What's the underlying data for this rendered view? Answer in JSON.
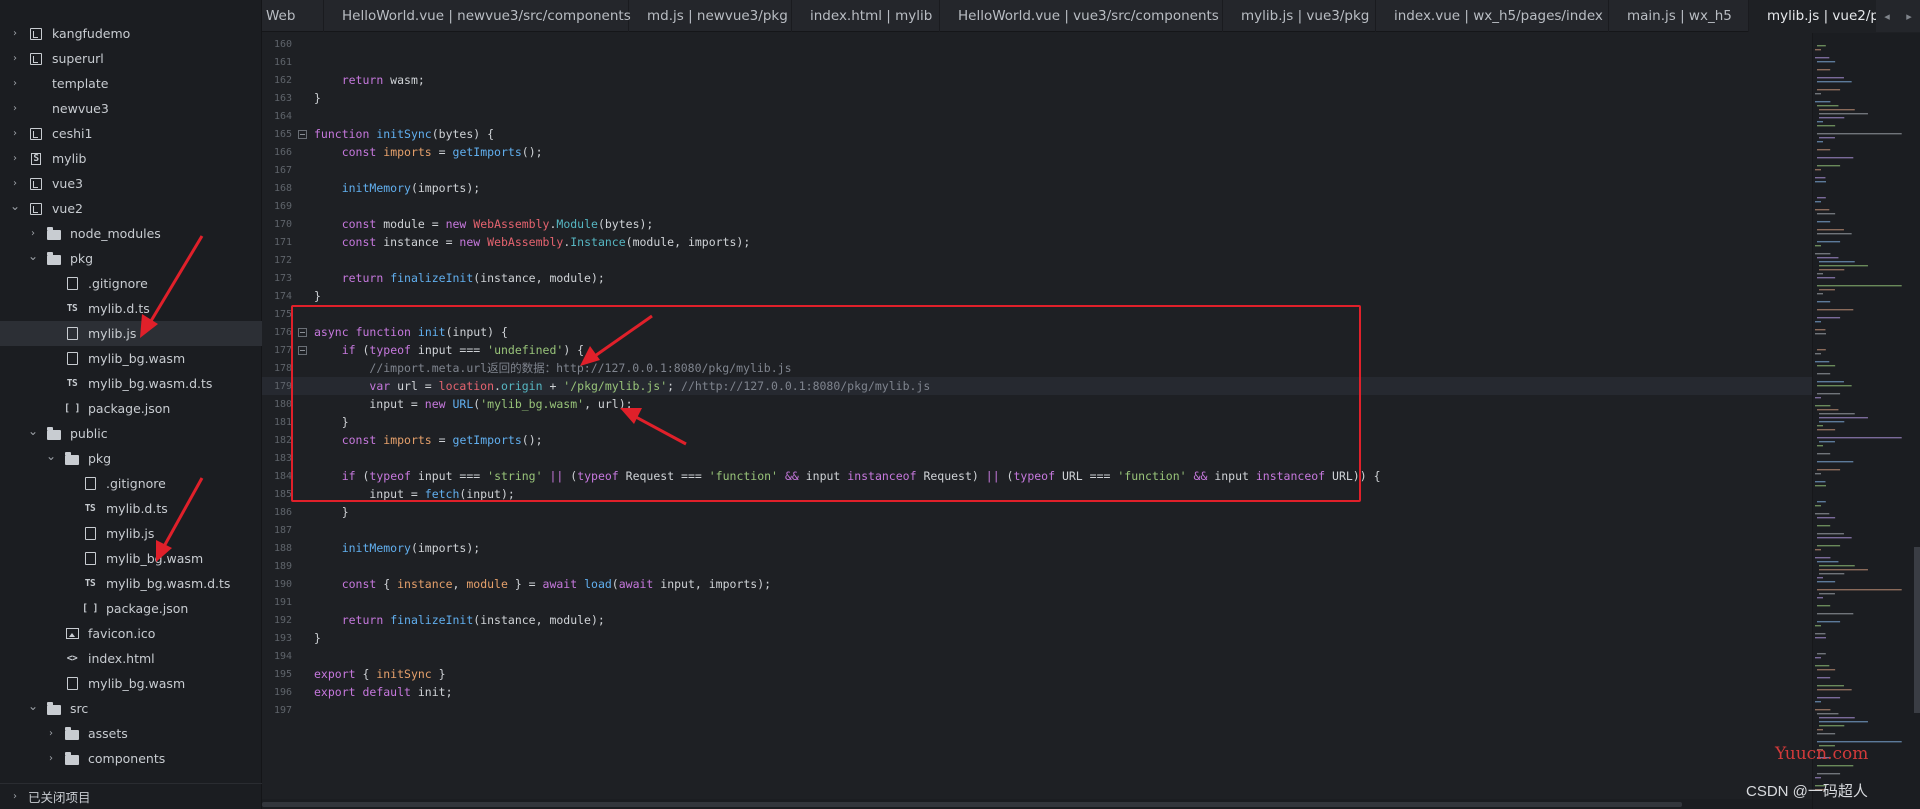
{
  "sidebar": {
    "items": [
      {
        "label": "kangfudemo",
        "depth": 0,
        "chevron": "right",
        "icon": "project-icon"
      },
      {
        "label": "superurl",
        "depth": 0,
        "chevron": "right",
        "icon": "project-icon"
      },
      {
        "label": "template",
        "depth": 0,
        "chevron": "right",
        "icon": "none"
      },
      {
        "label": "newvue3",
        "depth": 0,
        "chevron": "right",
        "icon": "none"
      },
      {
        "label": "ceshi1",
        "depth": 0,
        "chevron": "right",
        "icon": "project-icon"
      },
      {
        "label": "mylib",
        "depth": 0,
        "chevron": "right",
        "icon": "rust-project-icon"
      },
      {
        "label": "vue3",
        "depth": 0,
        "chevron": "right",
        "icon": "project-icon"
      },
      {
        "label": "vue2",
        "depth": 0,
        "chevron": "down",
        "icon": "project-icon"
      },
      {
        "label": "node_modules",
        "depth": 1,
        "chevron": "right",
        "icon": "folder-icon"
      },
      {
        "label": "pkg",
        "depth": 1,
        "chevron": "down",
        "icon": "folder-icon"
      },
      {
        "label": ".gitignore",
        "depth": 2,
        "chevron": "none",
        "icon": "file-icon"
      },
      {
        "label": "mylib.d.ts",
        "depth": 2,
        "chevron": "none",
        "icon": "ts-file-icon"
      },
      {
        "label": "mylib.js",
        "depth": 2,
        "chevron": "none",
        "icon": "js-file-icon",
        "selected": true
      },
      {
        "label": "mylib_bg.wasm",
        "depth": 2,
        "chevron": "none",
        "icon": "file-icon"
      },
      {
        "label": "mylib_bg.wasm.d.ts",
        "depth": 2,
        "chevron": "none",
        "icon": "ts-file-icon"
      },
      {
        "label": "package.json",
        "depth": 2,
        "chevron": "none",
        "icon": "json-file-icon"
      },
      {
        "label": "public",
        "depth": 1,
        "chevron": "down",
        "icon": "folder-icon"
      },
      {
        "label": "pkg",
        "depth": 2,
        "chevron": "down",
        "icon": "folder-icon"
      },
      {
        "label": ".gitignore",
        "depth": 3,
        "chevron": "none",
        "icon": "file-icon"
      },
      {
        "label": "mylib.d.ts",
        "depth": 3,
        "chevron": "none",
        "icon": "ts-file-icon"
      },
      {
        "label": "mylib.js",
        "depth": 3,
        "chevron": "none",
        "icon": "js-file-icon"
      },
      {
        "label": "mylib_bg.wasm",
        "depth": 3,
        "chevron": "none",
        "icon": "file-icon"
      },
      {
        "label": "mylib_bg.wasm.d.ts",
        "depth": 3,
        "chevron": "none",
        "icon": "ts-file-icon"
      },
      {
        "label": "package.json",
        "depth": 3,
        "chevron": "none",
        "icon": "json-file-icon"
      },
      {
        "label": "favicon.ico",
        "depth": 2,
        "chevron": "none",
        "icon": "image-file-icon"
      },
      {
        "label": "index.html",
        "depth": 2,
        "chevron": "none",
        "icon": "html-file-icon"
      },
      {
        "label": "mylib_bg.wasm",
        "depth": 2,
        "chevron": "none",
        "icon": "file-icon"
      },
      {
        "label": "src",
        "depth": 1,
        "chevron": "down",
        "icon": "folder-icon"
      },
      {
        "label": "assets",
        "depth": 2,
        "chevron": "right",
        "icon": "folder-icon"
      },
      {
        "label": "components",
        "depth": 2,
        "chevron": "right",
        "icon": "folder-icon"
      }
    ],
    "footer_label": "已关闭项目"
  },
  "tabs": [
    {
      "label": "Web",
      "active": false
    },
    {
      "label": "HelloWorld.vue | newvue3/src/components",
      "active": false
    },
    {
      "label": "md.js | newvue3/pkg",
      "active": false
    },
    {
      "label": "index.html | mylib",
      "active": false
    },
    {
      "label": "HelloWorld.vue | vue3/src/components",
      "active": false
    },
    {
      "label": "mylib.js | vue3/pkg",
      "active": false
    },
    {
      "label": "index.vue | wx_h5/pages/index",
      "active": false
    },
    {
      "label": "main.js | wx_h5",
      "active": false
    },
    {
      "label": "mylib.js | vue2/pkg",
      "active": true
    }
  ],
  "tab_nav": {
    "prev": "◂",
    "next": "▸"
  },
  "editor": {
    "current_line": 179,
    "lines": [
      {
        "n": 160,
        "fold": false,
        "tokens": []
      },
      {
        "n": 161,
        "fold": false,
        "tokens": []
      },
      {
        "n": 162,
        "fold": false,
        "tokens": [
          {
            "t": "    ",
            "c": ""
          },
          {
            "t": "return",
            "c": "kw"
          },
          {
            "t": " wasm;",
            "c": ""
          }
        ]
      },
      {
        "n": 163,
        "fold": false,
        "tokens": [
          {
            "t": "}",
            "c": ""
          }
        ]
      },
      {
        "n": 164,
        "fold": false,
        "tokens": []
      },
      {
        "n": 165,
        "fold": true,
        "tokens": [
          {
            "t": "function",
            "c": "kw"
          },
          {
            "t": " ",
            "c": ""
          },
          {
            "t": "initSync",
            "c": "fn"
          },
          {
            "t": "(bytes) {",
            "c": ""
          }
        ]
      },
      {
        "n": 166,
        "fold": false,
        "tokens": [
          {
            "t": "    ",
            "c": ""
          },
          {
            "t": "const",
            "c": "kw"
          },
          {
            "t": " ",
            "c": ""
          },
          {
            "t": "imports",
            "c": "var"
          },
          {
            "t": " = ",
            "c": ""
          },
          {
            "t": "getImports",
            "c": "fn"
          },
          {
            "t": "();",
            "c": ""
          }
        ]
      },
      {
        "n": 167,
        "fold": false,
        "tokens": []
      },
      {
        "n": 168,
        "fold": false,
        "tokens": [
          {
            "t": "    ",
            "c": ""
          },
          {
            "t": "initMemory",
            "c": "fn"
          },
          {
            "t": "(imports);",
            "c": ""
          }
        ]
      },
      {
        "n": 169,
        "fold": false,
        "tokens": []
      },
      {
        "n": 170,
        "fold": false,
        "tokens": [
          {
            "t": "    ",
            "c": ""
          },
          {
            "t": "const",
            "c": "kw"
          },
          {
            "t": " module = ",
            "c": ""
          },
          {
            "t": "new",
            "c": "kw"
          },
          {
            "t": " ",
            "c": ""
          },
          {
            "t": "WebAssembly",
            "c": "cls"
          },
          {
            "t": ".",
            "c": ""
          },
          {
            "t": "Module",
            "c": "prop"
          },
          {
            "t": "(bytes);",
            "c": ""
          }
        ]
      },
      {
        "n": 171,
        "fold": false,
        "tokens": [
          {
            "t": "    ",
            "c": ""
          },
          {
            "t": "const",
            "c": "kw"
          },
          {
            "t": " instance = ",
            "c": ""
          },
          {
            "t": "new",
            "c": "kw"
          },
          {
            "t": " ",
            "c": ""
          },
          {
            "t": "WebAssembly",
            "c": "cls"
          },
          {
            "t": ".",
            "c": ""
          },
          {
            "t": "Instance",
            "c": "prop"
          },
          {
            "t": "(module, imports);",
            "c": ""
          }
        ]
      },
      {
        "n": 172,
        "fold": false,
        "tokens": []
      },
      {
        "n": 173,
        "fold": false,
        "tokens": [
          {
            "t": "    ",
            "c": ""
          },
          {
            "t": "return",
            "c": "kw"
          },
          {
            "t": " ",
            "c": ""
          },
          {
            "t": "finalizeInit",
            "c": "fn"
          },
          {
            "t": "(instance, module);",
            "c": ""
          }
        ]
      },
      {
        "n": 174,
        "fold": false,
        "tokens": [
          {
            "t": "}",
            "c": ""
          }
        ]
      },
      {
        "n": 175,
        "fold": false,
        "tokens": []
      },
      {
        "n": 176,
        "fold": true,
        "tokens": [
          {
            "t": "async",
            "c": "kw"
          },
          {
            "t": " ",
            "c": ""
          },
          {
            "t": "function",
            "c": "kw"
          },
          {
            "t": " ",
            "c": ""
          },
          {
            "t": "init",
            "c": "fn"
          },
          {
            "t": "(input) {",
            "c": ""
          }
        ]
      },
      {
        "n": 177,
        "fold": true,
        "tokens": [
          {
            "t": "    ",
            "c": ""
          },
          {
            "t": "if",
            "c": "kw"
          },
          {
            "t": " (",
            "c": ""
          },
          {
            "t": "typeof",
            "c": "kw"
          },
          {
            "t": " input === ",
            "c": ""
          },
          {
            "t": "'undefined'",
            "c": "str"
          },
          {
            "t": ") {",
            "c": ""
          }
        ]
      },
      {
        "n": 178,
        "fold": false,
        "tokens": [
          {
            "t": "        ",
            "c": ""
          },
          {
            "t": "//import.meta.url返回的数据：http://127.0.0.1:8080/pkg/mylib.js",
            "c": "cmt"
          }
        ]
      },
      {
        "n": 179,
        "fold": false,
        "tokens": [
          {
            "t": "        ",
            "c": ""
          },
          {
            "t": "var",
            "c": "kw"
          },
          {
            "t": " url = ",
            "c": ""
          },
          {
            "t": "location",
            "c": "cls"
          },
          {
            "t": ".",
            "c": ""
          },
          {
            "t": "origin",
            "c": "prop"
          },
          {
            "t": " + ",
            "c": ""
          },
          {
            "t": "'/pkg/mylib.js'",
            "c": "str"
          },
          {
            "t": "; ",
            "c": ""
          },
          {
            "t": "//http://127.0.0.1:8080/pkg/mylib.js",
            "c": "cmt"
          }
        ]
      },
      {
        "n": 180,
        "fold": false,
        "tokens": [
          {
            "t": "        input = ",
            "c": ""
          },
          {
            "t": "new",
            "c": "kw"
          },
          {
            "t": " ",
            "c": ""
          },
          {
            "t": "URL",
            "c": "fn"
          },
          {
            "t": "(",
            "c": ""
          },
          {
            "t": "'mylib_bg.wasm'",
            "c": "str"
          },
          {
            "t": ", url);",
            "c": ""
          }
        ]
      },
      {
        "n": 181,
        "fold": false,
        "tokens": [
          {
            "t": "    }",
            "c": ""
          }
        ]
      },
      {
        "n": 182,
        "fold": false,
        "tokens": [
          {
            "t": "    ",
            "c": ""
          },
          {
            "t": "const",
            "c": "kw"
          },
          {
            "t": " ",
            "c": ""
          },
          {
            "t": "imports",
            "c": "var"
          },
          {
            "t": " = ",
            "c": ""
          },
          {
            "t": "getImports",
            "c": "fn"
          },
          {
            "t": "();",
            "c": ""
          }
        ]
      },
      {
        "n": 183,
        "fold": false,
        "tokens": []
      },
      {
        "n": 184,
        "fold": false,
        "tokens": [
          {
            "t": "    ",
            "c": ""
          },
          {
            "t": "if",
            "c": "kw"
          },
          {
            "t": " (",
            "c": ""
          },
          {
            "t": "typeof",
            "c": "kw"
          },
          {
            "t": " input === ",
            "c": ""
          },
          {
            "t": "'string'",
            "c": "str"
          },
          {
            "t": " ",
            "c": ""
          },
          {
            "t": "||",
            "c": "kw"
          },
          {
            "t": " (",
            "c": ""
          },
          {
            "t": "typeof",
            "c": "kw"
          },
          {
            "t": " Request === ",
            "c": ""
          },
          {
            "t": "'function'",
            "c": "str"
          },
          {
            "t": " ",
            "c": ""
          },
          {
            "t": "&&",
            "c": "kw"
          },
          {
            "t": " input ",
            "c": ""
          },
          {
            "t": "instanceof",
            "c": "kw"
          },
          {
            "t": " Request) ",
            "c": ""
          },
          {
            "t": "||",
            "c": "kw"
          },
          {
            "t": " (",
            "c": ""
          },
          {
            "t": "typeof",
            "c": "kw"
          },
          {
            "t": " URL === ",
            "c": ""
          },
          {
            "t": "'function'",
            "c": "str"
          },
          {
            "t": " ",
            "c": ""
          },
          {
            "t": "&&",
            "c": "kw"
          },
          {
            "t": " input ",
            "c": ""
          },
          {
            "t": "instanceof",
            "c": "kw"
          },
          {
            "t": " URL)) {",
            "c": ""
          }
        ]
      },
      {
        "n": 185,
        "fold": false,
        "tokens": [
          {
            "t": "        input = ",
            "c": ""
          },
          {
            "t": "fetch",
            "c": "fn"
          },
          {
            "t": "(input);",
            "c": ""
          }
        ]
      },
      {
        "n": 186,
        "fold": false,
        "tokens": [
          {
            "t": "    }",
            "c": ""
          }
        ]
      },
      {
        "n": 187,
        "fold": false,
        "tokens": []
      },
      {
        "n": 188,
        "fold": false,
        "tokens": [
          {
            "t": "    ",
            "c": ""
          },
          {
            "t": "initMemory",
            "c": "fn"
          },
          {
            "t": "(imports);",
            "c": ""
          }
        ]
      },
      {
        "n": 189,
        "fold": false,
        "tokens": []
      },
      {
        "n": 190,
        "fold": false,
        "tokens": [
          {
            "t": "    ",
            "c": ""
          },
          {
            "t": "const",
            "c": "kw"
          },
          {
            "t": " { ",
            "c": ""
          },
          {
            "t": "instance",
            "c": "var"
          },
          {
            "t": ", ",
            "c": ""
          },
          {
            "t": "module",
            "c": "var"
          },
          {
            "t": " } = ",
            "c": ""
          },
          {
            "t": "await",
            "c": "kw"
          },
          {
            "t": " ",
            "c": ""
          },
          {
            "t": "load",
            "c": "fn"
          },
          {
            "t": "(",
            "c": ""
          },
          {
            "t": "await",
            "c": "kw"
          },
          {
            "t": " input, imports);",
            "c": ""
          }
        ]
      },
      {
        "n": 191,
        "fold": false,
        "tokens": []
      },
      {
        "n": 192,
        "fold": false,
        "tokens": [
          {
            "t": "    ",
            "c": ""
          },
          {
            "t": "return",
            "c": "kw"
          },
          {
            "t": " ",
            "c": ""
          },
          {
            "t": "finalizeInit",
            "c": "fn"
          },
          {
            "t": "(instance, module);",
            "c": ""
          }
        ]
      },
      {
        "n": 193,
        "fold": false,
        "tokens": [
          {
            "t": "}",
            "c": ""
          }
        ]
      },
      {
        "n": 194,
        "fold": false,
        "tokens": []
      },
      {
        "n": 195,
        "fold": false,
        "tokens": [
          {
            "t": "export",
            "c": "kw"
          },
          {
            "t": " { ",
            "c": ""
          },
          {
            "t": "initSync",
            "c": "var"
          },
          {
            "t": " }",
            "c": ""
          }
        ]
      },
      {
        "n": 196,
        "fold": false,
        "tokens": [
          {
            "t": "export",
            "c": "kw"
          },
          {
            "t": " ",
            "c": ""
          },
          {
            "t": "default",
            "c": "kw"
          },
          {
            "t": " init;",
            "c": ""
          }
        ]
      },
      {
        "n": 197,
        "fold": false,
        "tokens": []
      }
    ]
  },
  "watermarks": {
    "site": "Yuucn.com",
    "author": "CSDN @一码超人"
  },
  "colors": {
    "annotation": "#e0202a",
    "accent_keyword": "#c678dd",
    "accent_string": "#98c379",
    "accent_function": "#61afef"
  }
}
